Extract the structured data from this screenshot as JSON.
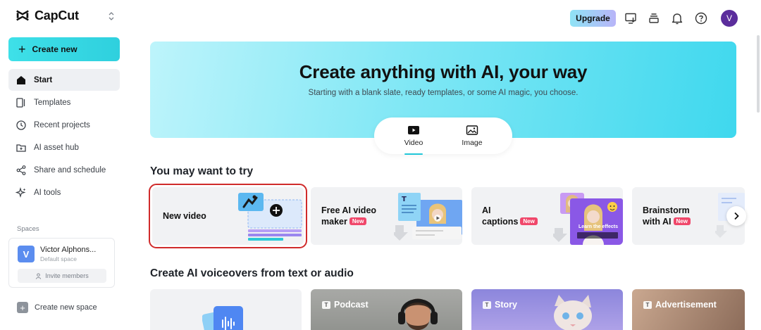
{
  "app": {
    "brand": "CapCut"
  },
  "sidebar": {
    "create_label": "Create new",
    "items": [
      {
        "label": "Start",
        "icon": "home-icon",
        "active": true
      },
      {
        "label": "Templates",
        "icon": "templates-icon"
      },
      {
        "label": "Recent projects",
        "icon": "clock-icon"
      },
      {
        "label": "AI asset hub",
        "icon": "asset-hub-icon"
      },
      {
        "label": "Share and schedule",
        "icon": "share-icon"
      },
      {
        "label": "AI tools",
        "icon": "sparkle-icon"
      }
    ],
    "spaces_label": "Spaces",
    "space": {
      "initial": "V",
      "name": "Victor Alphons...",
      "sub": "Default space",
      "invite_label": "Invite members"
    },
    "new_space_label": "Create new space"
  },
  "topbar": {
    "upgrade_label": "Upgrade",
    "avatar_initial": "V"
  },
  "hero": {
    "title": "Create anything with AI, your way",
    "subtitle": "Starting with a blank slate, ready templates, or some AI magic, you choose.",
    "tabs": [
      {
        "label": "Video",
        "active": true
      },
      {
        "label": "Image"
      }
    ]
  },
  "try_section": {
    "title": "You may want to try",
    "cards": [
      {
        "line1": "New video",
        "line2": ""
      },
      {
        "line1": "Free AI video",
        "line2": "maker",
        "badge": "New"
      },
      {
        "line1": "AI",
        "line2": "captions",
        "badge": "New"
      },
      {
        "line1": "Brainstorm",
        "line2": "with AI",
        "badge": "New"
      }
    ],
    "caption_overlay": "Learn the effects"
  },
  "voice_section": {
    "title": "Create AI voiceovers from text or audio",
    "cards": [
      {
        "label": ""
      },
      {
        "label": "Podcast",
        "tag": "T"
      },
      {
        "label": "Story",
        "tag": "T"
      },
      {
        "label": "Advertisement",
        "tag": "T"
      }
    ]
  },
  "colors": {
    "accent": "#2fd0de",
    "badge": "#f0476a",
    "selection": "#d02b2b",
    "avatar": "#5b2d9c"
  }
}
